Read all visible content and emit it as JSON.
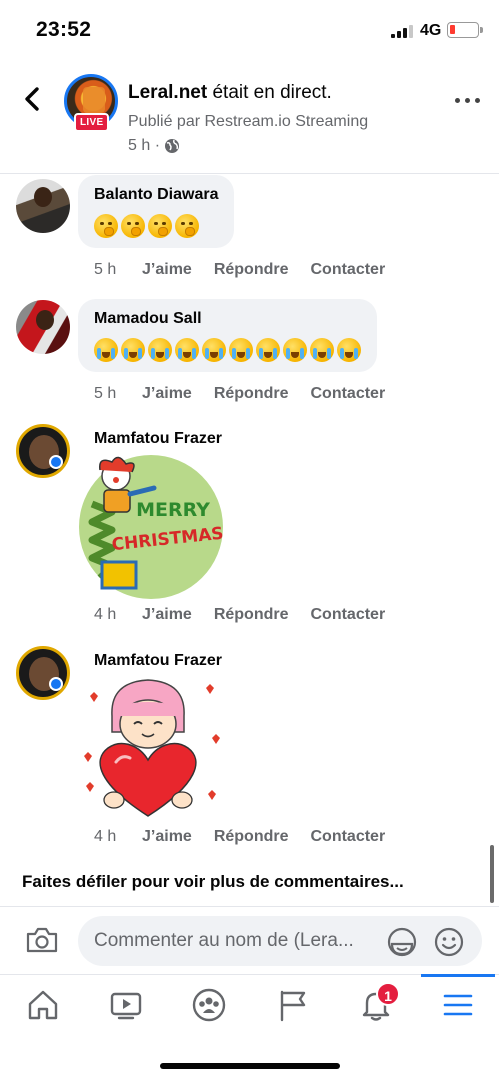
{
  "status_bar": {
    "time": "23:52",
    "network": "4G"
  },
  "header": {
    "page_name": "Leral.net",
    "title_suffix": " était en direct.",
    "publisher": "Publié par Restream.io Streaming",
    "time": "5 h ·",
    "live_label": "LIVE"
  },
  "comments": [
    {
      "author": "Balanto Diawara",
      "emoji_type": "shushing-face",
      "emoji_count": 4,
      "time": "5 h"
    },
    {
      "author": "Mamadou Sall",
      "emoji_type": "loudly-crying-face",
      "emoji_count": 10,
      "time": "5 h"
    },
    {
      "author": "Mamfatou Frazer",
      "sticker": "merry-christmas-jester",
      "sticker_text": [
        "MERRY",
        "CHRISTMAS!"
      ],
      "time": "4 h"
    },
    {
      "author": "Mamfatou Frazer",
      "sticker": "girl-holding-heart",
      "time": "4 h"
    }
  ],
  "actions": {
    "like": "J’aime",
    "reply": "Répondre",
    "contact": "Contacter"
  },
  "scroll_more": "Faites défiler pour voir plus de commentaires...",
  "composer": {
    "placeholder": "Commenter au nom de (Lera..."
  },
  "tabbar": {
    "items": [
      "home",
      "watch",
      "groups",
      "pages",
      "notifications",
      "menu"
    ],
    "active": "menu",
    "notification_count": "1"
  },
  "colors": {
    "accent": "#1877f2",
    "live": "#e41e3f",
    "secondary_text": "#65676b",
    "bubble": "#f0f2f5"
  }
}
